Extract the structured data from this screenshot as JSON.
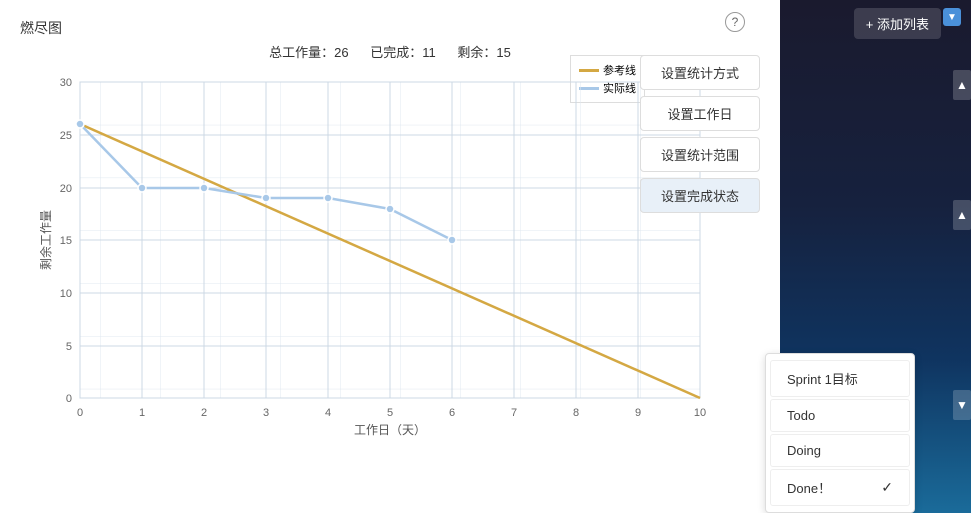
{
  "chart": {
    "title": "燃尽图",
    "stats": {
      "total_label": "总工作量：26",
      "done_label": "已完成：11",
      "remaining_label": "剩余：15"
    },
    "y_axis_label": "剩余工作量",
    "x_axis_label": "工作日（天）",
    "legend": {
      "reference_label": "参考线",
      "actual_label": "实际线",
      "reference_color": "#d4a843",
      "actual_color": "#a8c8e8"
    },
    "y_ticks": [
      0,
      5,
      10,
      15,
      20,
      25,
      30
    ],
    "x_ticks": [
      0,
      1,
      2,
      3,
      4,
      5,
      6,
      7,
      8,
      9,
      10
    ]
  },
  "toolbar": {
    "set_stats_btn": "设置统计方式",
    "set_workday_btn": "设置工作日",
    "set_range_btn": "设置统计范围",
    "set_status_btn": "设置完成状态"
  },
  "status_menu": {
    "items": [
      {
        "id": "sprint1",
        "label": "Sprint 1目标",
        "checked": false
      },
      {
        "id": "todo",
        "label": "Todo",
        "checked": false
      },
      {
        "id": "doing",
        "label": "Doing",
        "checked": false
      },
      {
        "id": "done",
        "label": "Done！",
        "checked": true
      }
    ]
  },
  "right_panel": {
    "add_list_btn": "+ 添加列表"
  },
  "help": {
    "icon": "?"
  }
}
